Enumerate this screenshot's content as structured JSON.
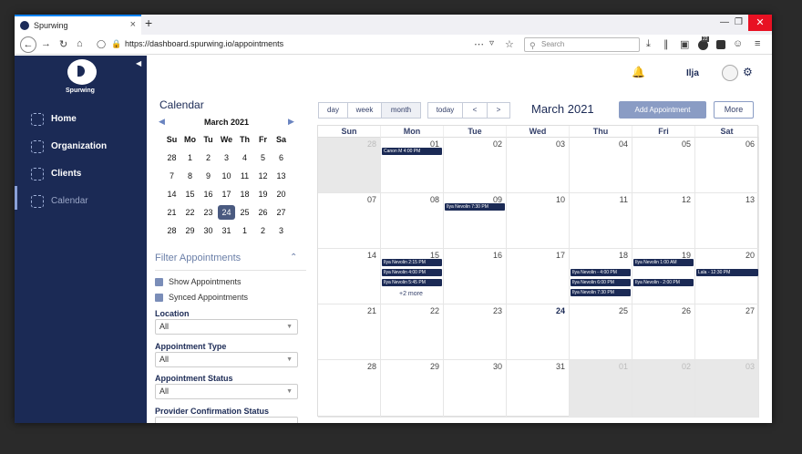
{
  "browser": {
    "tab_title": "Spurwing",
    "tab_close": "×",
    "new_tab": "+",
    "url": "https://dashboard.spurwing.io/appointments",
    "search_placeholder": "Search",
    "icons": [
      "back-icon",
      "forward-icon",
      "reload-icon",
      "home-icon",
      "shield-icon",
      "lock-icon",
      "menu-dots-icon",
      "pocket-icon",
      "star-icon",
      "download-icon",
      "library-icon",
      "reader-icon",
      "extension-icon",
      "profile-icon",
      "hamburger-icon"
    ],
    "badge_count": "22"
  },
  "sidebar": {
    "brand": "Spurwing",
    "items": [
      {
        "label": "Home"
      },
      {
        "label": "Organization"
      },
      {
        "label": "Clients"
      },
      {
        "label": "Calendar"
      }
    ]
  },
  "header": {
    "user": "Ilja"
  },
  "left_panel": {
    "title": "Calendar",
    "mini_calendar": {
      "month": "March 2021",
      "weekdays": [
        "Su",
        "Mo",
        "Tu",
        "We",
        "Th",
        "Fr",
        "Sa"
      ],
      "weeks": [
        [
          "28",
          "1",
          "2",
          "3",
          "4",
          "5",
          "6"
        ],
        [
          "7",
          "8",
          "9",
          "10",
          "11",
          "12",
          "13"
        ],
        [
          "14",
          "15",
          "16",
          "17",
          "18",
          "19",
          "20"
        ],
        [
          "21",
          "22",
          "23",
          "24",
          "25",
          "26",
          "27"
        ],
        [
          "28",
          "29",
          "30",
          "31",
          "1",
          "2",
          "3"
        ]
      ],
      "selected": "24"
    },
    "filter": {
      "title": "Filter Appointments",
      "show_appointments": "Show Appointments",
      "synced_appointments": "Synced Appointments",
      "location_label": "Location",
      "location_value": "All",
      "type_label": "Appointment Type",
      "type_value": "All",
      "status_label": "Appointment Status",
      "status_value": "All",
      "provider_label": "Provider Confirmation Status"
    }
  },
  "toolbar": {
    "day": "day",
    "week": "week",
    "month": "month",
    "today": "today",
    "prev": "<",
    "next": ">",
    "title": "March 2021",
    "add": "Add Appointment",
    "more": "More"
  },
  "calendar": {
    "weekdays": [
      "Sun",
      "Mon",
      "Tue",
      "Wed",
      "Thu",
      "Fri",
      "Sat"
    ],
    "weeks": [
      [
        "28",
        "01",
        "02",
        "03",
        "04",
        "05",
        "06"
      ],
      [
        "07",
        "08",
        "09",
        "10",
        "11",
        "12",
        "13"
      ],
      [
        "14",
        "15",
        "16",
        "17",
        "18",
        "19",
        "20"
      ],
      [
        "21",
        "22",
        "23",
        "24",
        "25",
        "26",
        "27"
      ],
      [
        "28",
        "29",
        "30",
        "31",
        "01",
        "02",
        "03"
      ]
    ],
    "grey_cells": [
      "0-0",
      "4-4",
      "4-5",
      "4-6"
    ],
    "today_cell": "3-3",
    "events": [
      {
        "cell": "0-1",
        "slot": 0,
        "text": "Canon M 4:00 PM"
      },
      {
        "cell": "1-2",
        "slot": 0,
        "text": "Ilya Nevolin 7:30 PM"
      },
      {
        "cell": "2-1",
        "slot": 0,
        "text": "Ilya Nevolin 2:15 PM"
      },
      {
        "cell": "2-1",
        "slot": 1,
        "text": "Ilya Nevolin 4:00 PM"
      },
      {
        "cell": "2-1",
        "slot": 2,
        "text": "Ilya Nevolin 5:45 PM"
      },
      {
        "cell": "2-4",
        "slot": 1,
        "text": "Ilya Nevolin - 4:00 PM"
      },
      {
        "cell": "2-4",
        "slot": 2,
        "text": "Ilya Nevolin 6:00 PM"
      },
      {
        "cell": "2-4",
        "slot": 3,
        "text": "Ilya Nevolin 7:30 PM"
      },
      {
        "cell": "2-5",
        "slot": 0,
        "text": "Ilya Nevolin 1:00 AM"
      },
      {
        "cell": "2-5",
        "slot": 2,
        "text": "Ilya Nevolin - 2:00 PM"
      },
      {
        "cell": "2-6",
        "slot": 1,
        "text": "Lala - 12:30 PM"
      }
    ],
    "more_link": "+2 more"
  }
}
